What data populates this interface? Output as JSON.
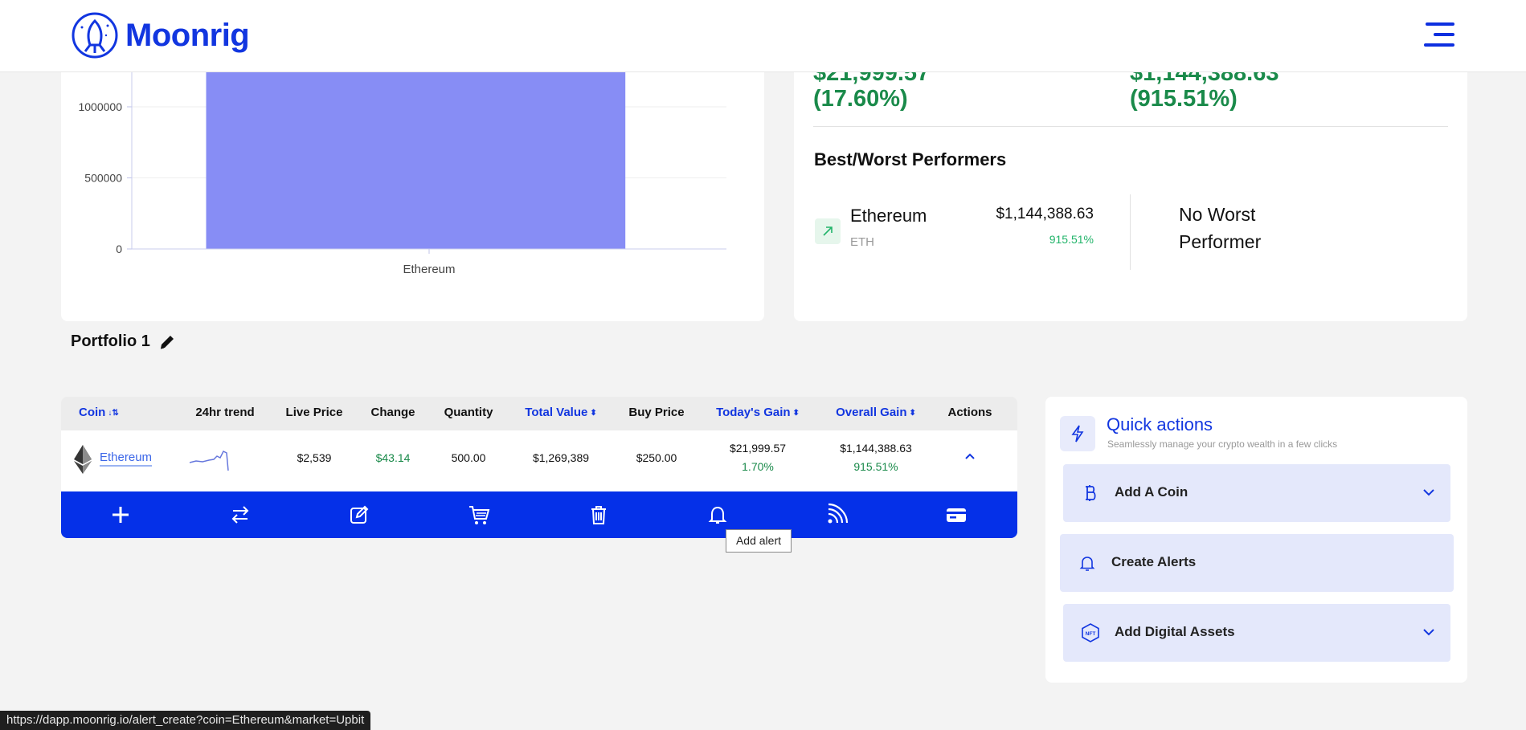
{
  "brand": {
    "name": "Moonrig"
  },
  "chart_data": {
    "type": "bar",
    "categories": [
      "Ethereum"
    ],
    "values": [
      1269389
    ],
    "yticks": [
      "0",
      "500000",
      "1000000"
    ],
    "ylim": [
      0,
      1400000
    ],
    "color": "#878df5"
  },
  "summary": {
    "todays_gain_value": "$21,999.57",
    "todays_gain_pct": "(17.60%)",
    "overall_gain_value": "$1,144,388.63",
    "overall_gain_pct": "(915.51%)",
    "best_worst_title": "Best/Worst Performers",
    "best": {
      "name": "Ethereum",
      "symbol": "ETH",
      "value": "$1,144,388.63",
      "pct": "915.51%"
    },
    "worst_text": "No Worst Performer"
  },
  "portfolio": {
    "name": "Portfolio 1"
  },
  "table": {
    "headers": {
      "coin": "Coin",
      "trend": "24hr trend",
      "live_price": "Live Price",
      "change": "Change",
      "quantity": "Quantity",
      "total_value": "Total Value",
      "buy_price": "Buy Price",
      "todays_gain": "Today's Gain",
      "overall_gain": "Overall Gain",
      "actions": "Actions"
    },
    "row": {
      "coin": "Ethereum",
      "live_price": "$2,539",
      "change": "$43.14",
      "quantity": "500.00",
      "total_value": "$1,269,389",
      "buy_price": "$250.00",
      "todays_gain": "$21,999.57",
      "todays_gain_pct": "1.70%",
      "overall_gain": "$1,144,388.63",
      "overall_gain_pct": "915.51%"
    },
    "tooltip": "Add alert"
  },
  "quick_actions": {
    "title": "Quick actions",
    "subtitle": "Seamlessly manage your crypto wealth in a few clicks",
    "items": [
      {
        "label": "Add A Coin",
        "icon": "bitcoin-icon"
      },
      {
        "label": "Create Alerts",
        "icon": "bell-icon"
      },
      {
        "label": "Add Digital Assets",
        "icon": "nft-icon"
      }
    ]
  },
  "status_url": "https://dapp.moonrig.io/alert_create?coin=Ethereum&market=Upbit"
}
